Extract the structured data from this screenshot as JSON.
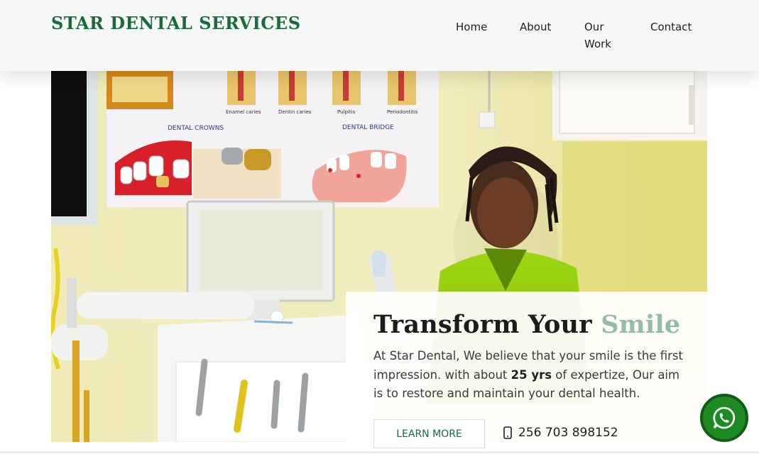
{
  "header": {
    "brand": "STAR DENTAL SERVICES",
    "nav": {
      "home": "Home",
      "about": "About",
      "our_work": "Our Work",
      "contact": "Contact"
    }
  },
  "hero": {
    "poster": {
      "crowns_label": "DENTAL CROWNS",
      "bridge_label": "DENTAL BRIDGE",
      "caption_1": "Enamel caries",
      "caption_2": "Dentin caries",
      "caption_3": "Pulpitis",
      "caption_4": "Periodontitis"
    },
    "title_main": "Transform Your ",
    "title_accent": "Smile",
    "text_before": "At Star Dental, We believe that your smile is the first impression. with about ",
    "text_bold": "25 yrs",
    "text_after": " of expertize, Our aim is to restore and maintain your dental health.",
    "cta_label": "LEARN MORE",
    "phone": "256 703 898152"
  },
  "colors": {
    "brand_green": "#176c3c",
    "accent_sage": "#92bea8",
    "whatsapp_green": "#1e8a24"
  },
  "icons": {
    "phone": "mobile-phone-icon",
    "whatsapp": "whatsapp-icon"
  }
}
